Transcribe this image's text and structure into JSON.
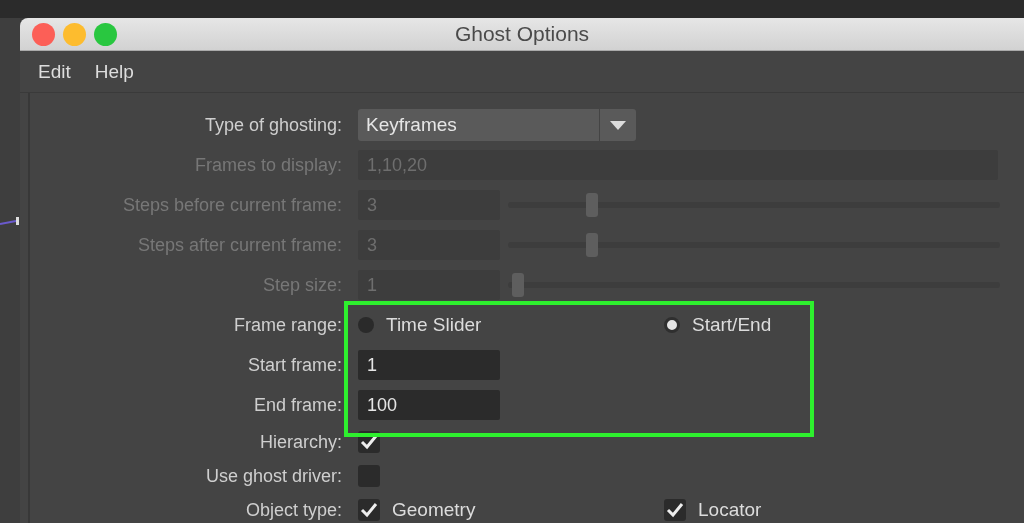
{
  "window": {
    "title": "Ghost Options"
  },
  "menu": [
    {
      "label": "Edit"
    },
    {
      "label": "Help"
    }
  ],
  "rows": [
    {
      "kind": "dropdown",
      "label": "Type of ghosting:",
      "value": "Keyframes",
      "disabled": false
    },
    {
      "kind": "text",
      "label": "Frames to display:",
      "value": "1,10,20",
      "disabled": true
    },
    {
      "kind": "slider",
      "label": "Steps before current frame:",
      "value": "3",
      "level": 0.17,
      "disabled": true
    },
    {
      "kind": "slider",
      "label": "Steps after current frame:",
      "value": "3",
      "level": 0.17,
      "disabled": true
    },
    {
      "kind": "slider",
      "label": "Step size:",
      "value": "1",
      "level": 0.02,
      "disabled": true
    },
    {
      "kind": "radio",
      "label": "Frame range:",
      "disabled": false,
      "options": [
        {
          "label": "Time Slider",
          "selected": false
        },
        {
          "label": "Start/End",
          "selected": true
        }
      ]
    },
    {
      "kind": "number",
      "label": "Start frame:",
      "value": "1",
      "disabled": false
    },
    {
      "kind": "number",
      "label": "End frame:",
      "value": "100",
      "disabled": false
    },
    {
      "kind": "checkbox",
      "label": "Hierarchy:",
      "checked": true,
      "disabled": false
    },
    {
      "kind": "checkbox",
      "label": "Use ghost driver:",
      "checked": false,
      "disabled": false
    },
    {
      "kind": "checks",
      "label": "Object type:",
      "disabled": false,
      "options": [
        {
          "label": "Geometry",
          "checked": true
        },
        {
          "label": "Locator",
          "checked": true
        }
      ]
    }
  ]
}
